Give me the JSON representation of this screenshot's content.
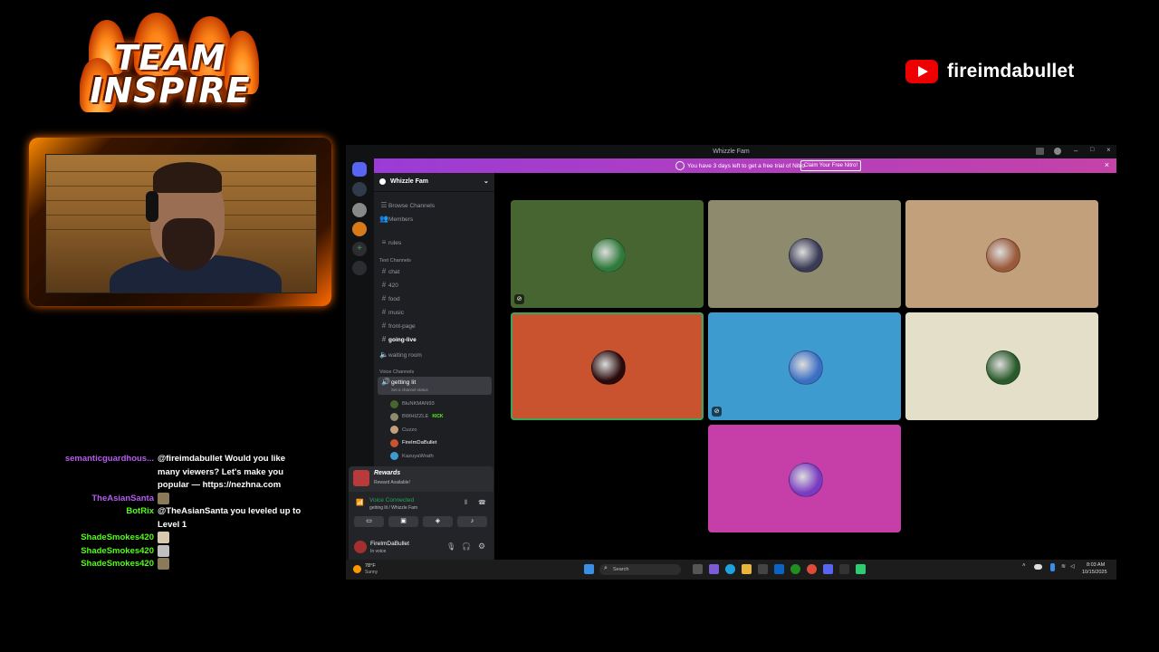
{
  "overlay": {
    "team_logo": [
      "TEAM",
      "INSPIRE"
    ],
    "youtube_channel": "fireimdabullet"
  },
  "chat": [
    {
      "user": "semanticguardhous...",
      "color": "#b65cf0",
      "message": "@fireimdabullet Would you like many viewers? Let's make you popular — https://nezhna.com",
      "emote": false
    },
    {
      "user": "TheAsianSanta",
      "color": "#b65cf0",
      "message": "",
      "emote": true
    },
    {
      "user": "BotRix",
      "color": "#53fc18",
      "message": "@TheAsianSanta you leveled up to Level 1",
      "emote": false
    },
    {
      "user": "ShadeSmokes420",
      "color": "#53fc18",
      "message": "",
      "emote": true
    },
    {
      "user": "ShadeSmokes420",
      "color": "#53fc18",
      "message": "",
      "emote": true
    },
    {
      "user": "ShadeSmokes420",
      "color": "#53fc18",
      "message": "",
      "emote": true
    }
  ],
  "discord": {
    "window_title": "Whizzle Fam",
    "nitro_banner": "You have 3 days left to get a free trial of Nitro",
    "nitro_button": "Claim Your Free Nitro!",
    "server_name": "Whizzle Fam",
    "nav": [
      "Browse Channels",
      "Members"
    ],
    "rules": "rules",
    "text_category": "Text Channels",
    "text_channels": [
      "chat",
      "420",
      "food",
      "music",
      "front-page",
      "going-live"
    ],
    "waiting_room": "waiting room",
    "voice_category": "Voice Channels",
    "voice_channel": "getting lit",
    "voice_status": "Set a channel status",
    "voice_users": [
      "BluNKMAN93",
      "BWHIZZLE",
      "Cuzzo",
      "FireImDaBullet",
      "KazuyaWrath"
    ],
    "kick_badge": "KICK",
    "reward_title": "Reward Available!",
    "reward_logo": "Rewards",
    "voice_connected": "Voice Connected",
    "voice_location": "getting lit / Whizzle Fam",
    "user_name": "FireImDaBullet",
    "user_status": "In voice",
    "tile_colors": [
      "#476530",
      "#8d8a6d",
      "#c3a07c",
      "#c9532f",
      "#3d9bd0",
      "#e3dfc9",
      "#c63fa8"
    ]
  },
  "taskbar": {
    "weather_temp": "78°F",
    "weather_desc": "Sunny",
    "search_placeholder": "Search",
    "time": "8:03 AM",
    "date": "10/15/2025"
  }
}
